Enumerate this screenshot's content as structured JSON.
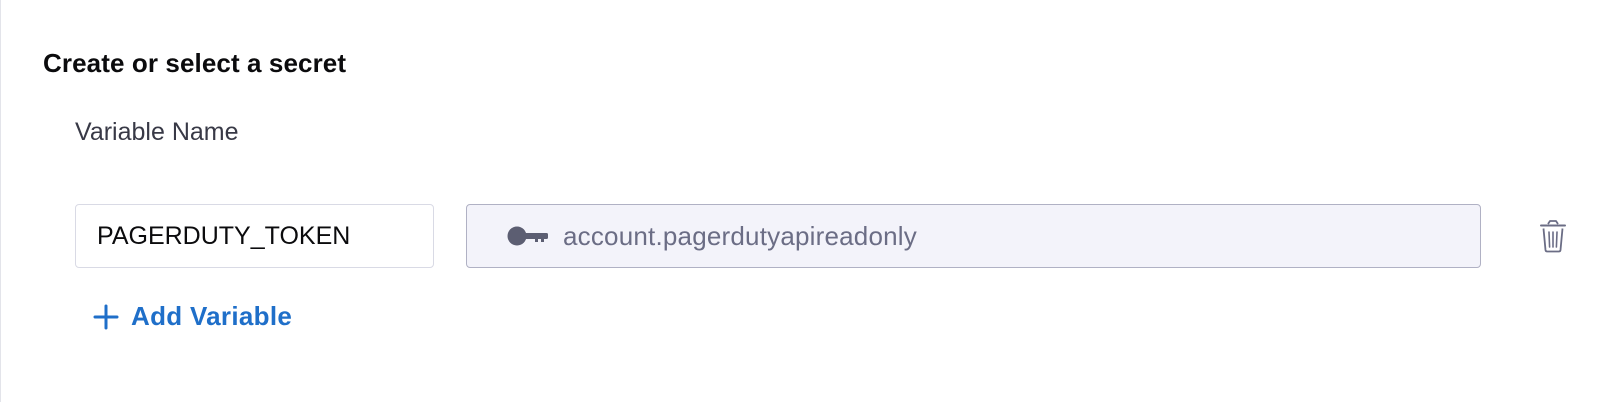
{
  "section": {
    "title": "Create or select a secret"
  },
  "variables": {
    "column_label": "Variable Name",
    "rows": [
      {
        "name": "PAGERDUTY_TOKEN",
        "secret_ref": "account.pagerdutyapireadonly"
      }
    ]
  },
  "actions": {
    "add_variable_label": "Add Variable"
  },
  "icons": {
    "secret": "key-icon",
    "delete": "trash-icon",
    "add": "plus-icon"
  },
  "colors": {
    "accent": "#1f6fc9",
    "secret_field_bg": "#f3f3fa",
    "muted_text": "#6b6d85",
    "icon_gray": "#5c5e72"
  }
}
